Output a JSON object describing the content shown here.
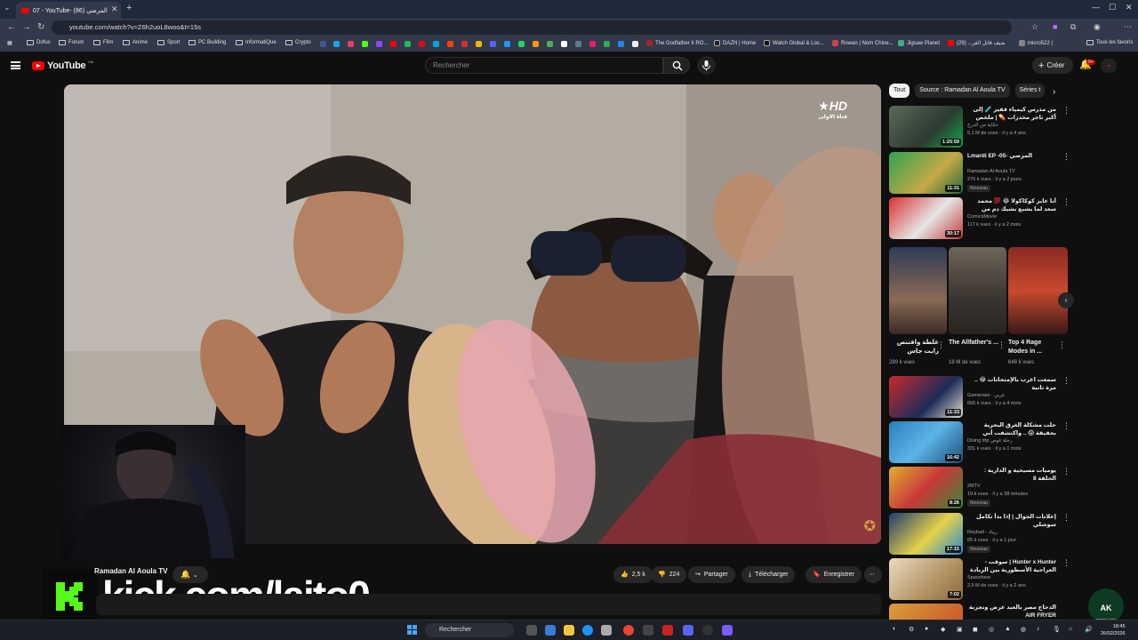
{
  "browser": {
    "tab_title": "07 - YouTube- المرضي (86)",
    "url": "youtube.com/watch?v=Z6h2uoL8woo&t=15s",
    "bookmarks": [
      "Dofus",
      "Forum",
      "Film",
      "Animé",
      "Sport",
      "PC Building",
      "InformatiQue",
      "Crypto",
      "The Godfather II RO...",
      "DAZN | Home",
      "Watch Global & Loc...",
      "Rowan | Nom Chine...",
      "Jigsaw Planet",
      "ضيف قاتل القر... (29)",
      "micro522 |",
      "Tous les favoris"
    ]
  },
  "youtube": {
    "logo_text": "YouTube",
    "logo_region": "MA",
    "search_placeholder": "Rechercher",
    "create_label": "Créer",
    "notif_count": "9+"
  },
  "video": {
    "watermark": "HD",
    "watermark_sub": "قناة الاولى",
    "channel": "Ramadan Al Aoula TV",
    "likes": "2,5 k",
    "dislikes": "224",
    "share": "Partager",
    "download": "Télécharger",
    "save": "Enregistrer"
  },
  "overlay": {
    "kick_text": "kick.com/laito0"
  },
  "sidebar": {
    "chips": [
      "Tout",
      "Source : Ramadan Al Aoula TV",
      "Séries t"
    ],
    "videos": [
      {
        "title": "من مدرس كيمياء فقير 🧪 إلى أكبر تاجر مخدرات 💊 | ملخص مسلسل",
        "channel": "حكاية من الدرج",
        "meta": "5,1 M de vues · il y a 4 ans",
        "duration": "1:25:59",
        "badge": ""
      },
      {
        "title": "Lmardi EP -05- المرضي",
        "channel": "Ramadan Al Aoula TV",
        "meta": "276 k vues · il y a 2 jours",
        "duration": "11:31",
        "badge": "Nouveau"
      },
      {
        "title": "أنا عايز كوكاكولا 😂 💯 محمد سعد لما يشبع بشيك دم من سرحان عبد البصير",
        "channel": "ComicsMovie",
        "meta": "117 k vues · il y a 2 mois",
        "duration": "30:17",
        "badge": ""
      },
      {
        "title": "سمعت اغرب بالإمتحانات 😂 .. مرة ثانية",
        "channel": "Gamerawi - عربي",
        "meta": "656 k vues · il y a 4 mois",
        "duration": "11:33",
        "badge": ""
      },
      {
        "title": "حلت مشكلة الغرق البحرية بحقيقة 😱 .. واكتشفت أني لست وحيد",
        "channel": "Diving trip رحلة غوص",
        "meta": "331 k vues · il y a 1 mois",
        "duration": "16:42",
        "badge": ""
      },
      {
        "title": "يوميات مسيحية و الدارية : الحلقة 8",
        "channel": "2MTV",
        "meta": "19 k vues · il y a 38 minutes",
        "duration": "8:26",
        "badge": "Nouveau"
      },
      {
        "title": "إعلانات الجوال | إذا بدأ تكامل سوشلي",
        "channel": "Reybad - ريباد",
        "meta": "65 k vues · il y a 1 jour",
        "duration": "17:15",
        "badge": "Nouveau"
      },
      {
        "title": "Hunter x Hunter | سوفت - العراجية الأسطورية بين الزيادة والخسائر",
        "channel": "Spacetoon",
        "meta": "2,5 M de vues · il y a 2 ans",
        "duration": "7:02",
        "badge": ""
      },
      {
        "title": "الدجاج مصر بالعيد عرض وتجربة AIR FRYER",
        "channel": "",
        "meta": "",
        "duration": "",
        "badge": ""
      }
    ],
    "shorts": [
      {
        "title": "غلطة واقتنص رايت جاس فريدج",
        "views": "289 k vues"
      },
      {
        "title": "The Allfather's ...",
        "views": "18 M de vues"
      },
      {
        "title": "Top 4 Rage Modes in ...",
        "views": "648 k vues"
      }
    ]
  },
  "taskbar": {
    "search": "Rechercher",
    "time": "18:45",
    "date": "26/02/2026"
  },
  "badge_logo": {
    "text": "AK",
    "sub": "STREAMER"
  }
}
